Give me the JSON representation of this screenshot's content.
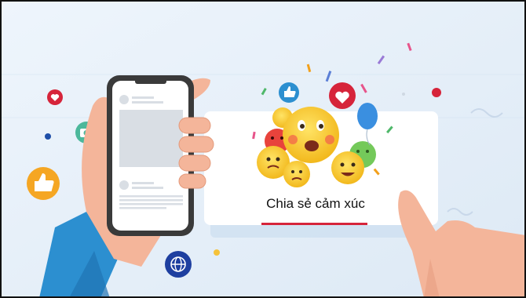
{
  "card": {
    "caption": "Chia sẻ cảm xúc",
    "underline_color": "#d6243a"
  },
  "icons": [
    "heart-icon",
    "camera-icon",
    "thumbs-up-icon",
    "globe-icon",
    "like-icon",
    "balloon-icon"
  ],
  "colors": {
    "background": "#e6f0f9",
    "card": "#ffffff",
    "phone_frame": "#3a3a3a",
    "sleeve": "#2c8fd0",
    "emoji_yellow": "#f7c623",
    "accent_red": "#d6243a"
  }
}
